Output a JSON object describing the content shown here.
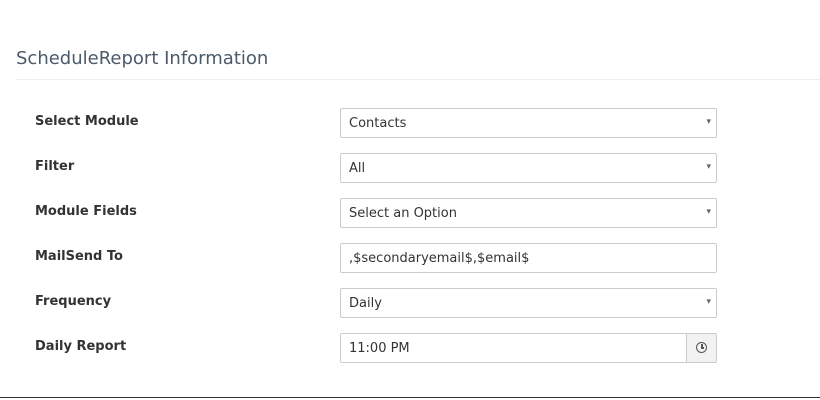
{
  "section": {
    "title": "ScheduleReport Information"
  },
  "fields": {
    "select_module": {
      "label": "Select Module",
      "value": "Contacts"
    },
    "filter": {
      "label": "Filter",
      "value": "All"
    },
    "module_fields": {
      "label": "Module Fields",
      "value": "Select an Option"
    },
    "mail_send_to": {
      "label": "MailSend To",
      "value": ",$secondaryemail$,$email$"
    },
    "frequency": {
      "label": "Frequency",
      "value": "Daily"
    },
    "daily_report": {
      "label": "Daily Report",
      "value": "11:00 PM"
    }
  },
  "icons": {
    "dropdown": "caret-down-icon",
    "time": "clock-icon"
  },
  "glyphs": {
    "caret": "▾"
  },
  "colors": {
    "title": "#4a5a6a",
    "label": "#333333",
    "border": "#cccccc",
    "addon_bg": "#f2f2f2"
  }
}
